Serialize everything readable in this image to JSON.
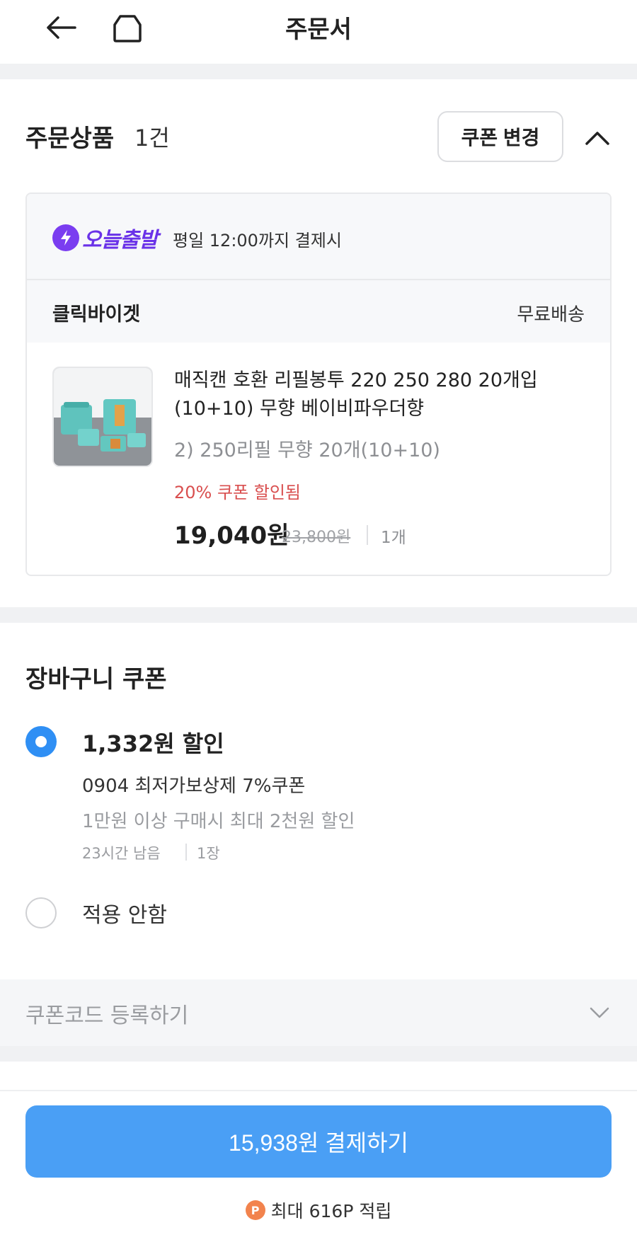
{
  "header": {
    "title": "주문서",
    "back_icon": "arrow-left-icon",
    "home_icon": "home-icon"
  },
  "order": {
    "section_title": "주문상품",
    "count": "1건",
    "coupon_change_label": "쿠폰 변경",
    "departure": {
      "badge": "오늘출발",
      "note": "평일 12:00까지 결제시"
    },
    "seller": {
      "name": "클릭바이겟",
      "shipping": "무료배송"
    },
    "product": {
      "name": "매직캔 호환 리필봉투 220 250 280 20개입 (10+10) 무향 베이비파우더향",
      "option": "2) 250리필 무향 20개(10+10)",
      "discount_note": "20% 쿠폰 할인됨",
      "price": "19,040원",
      "original_price": "23,800원",
      "quantity": "1개"
    }
  },
  "cart_coupon": {
    "section_title": "장바구니 쿠폰",
    "option_selected": {
      "amount": "1,332원 할인",
      "name": "0904 최저가보상제 7%쿠폰",
      "condition": "1만원 이상 구매시 최대 2천원 할인",
      "remaining": "23시간 남음",
      "count": "1장"
    },
    "option_none": "적용 안함",
    "code_register": "쿠폰코드 등록하기"
  },
  "footer": {
    "pay_label": "15,938원 결제하기",
    "points_icon": "P",
    "points_text": "최대 616P 적립"
  },
  "colors": {
    "accent": "#4a9ff5",
    "radio": "#2f8ff4",
    "discount": "#d94f4f",
    "badge": "#6a32e8",
    "points": "#f2834d"
  }
}
